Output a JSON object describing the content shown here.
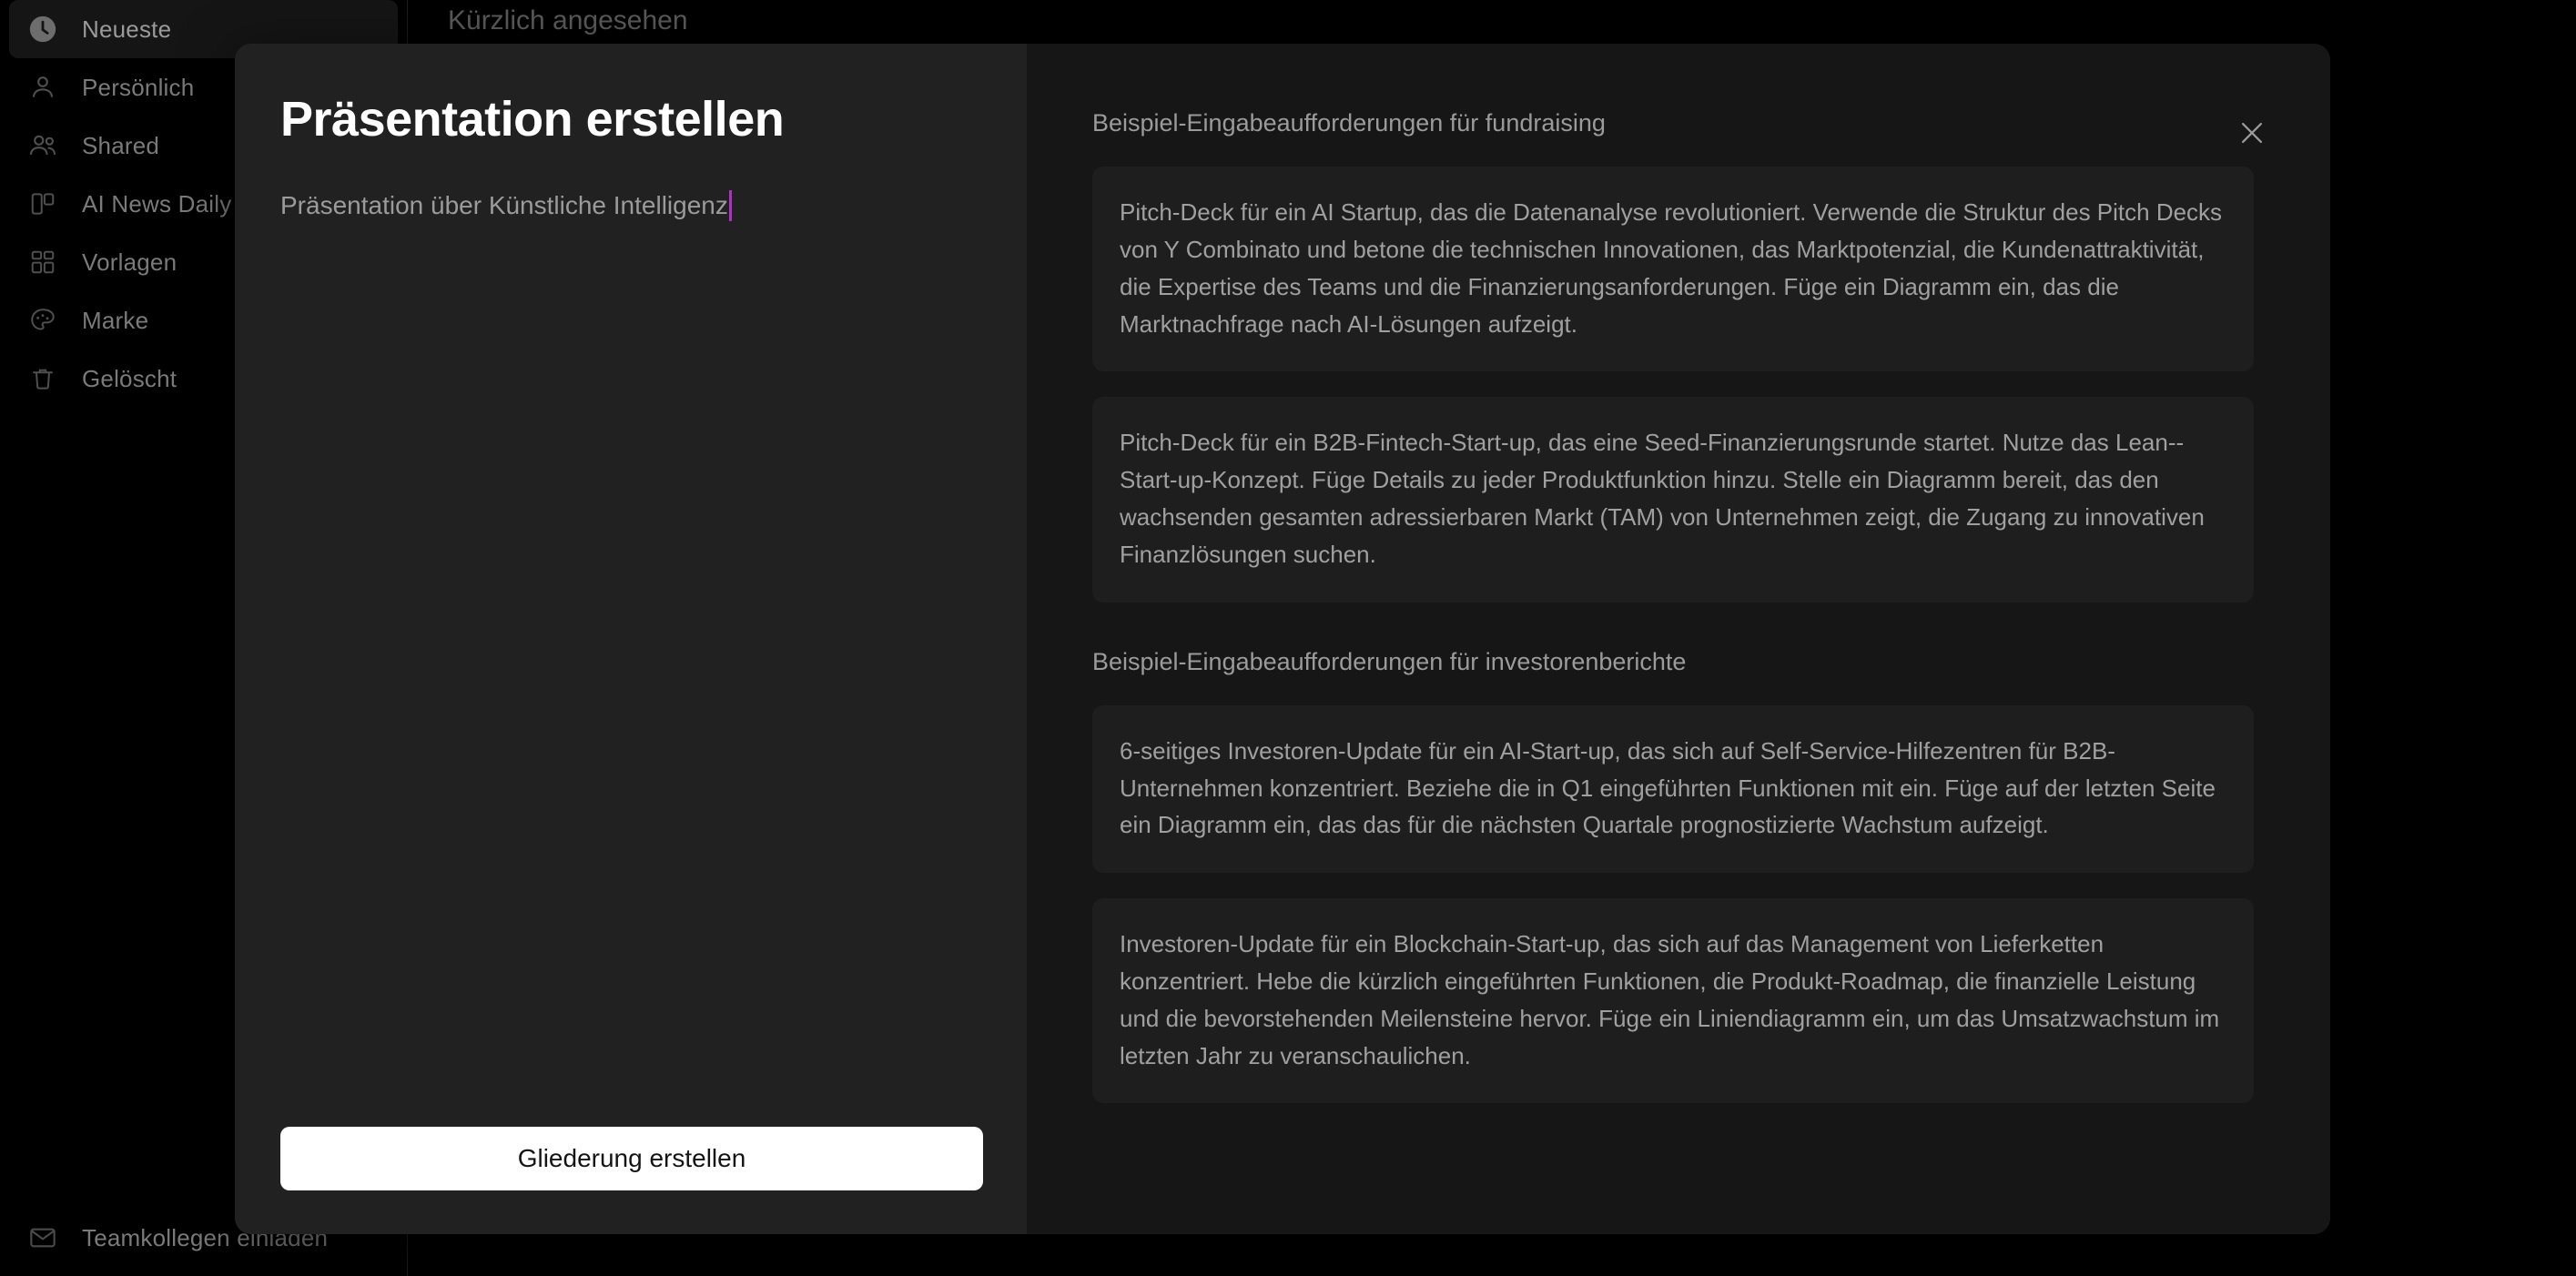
{
  "colors": {
    "page_bg": "#000000",
    "modal_left_bg": "#212121",
    "modal_right_bg": "#161616",
    "card_bg": "#1e1e1e",
    "caret": "#b02fc4",
    "cta_bg": "#ffffff",
    "cta_text": "#141414",
    "muted_text": "#9b9b9b"
  },
  "sidebar": {
    "items": [
      {
        "label": "Neueste",
        "icon": "clock-icon",
        "active": true
      },
      {
        "label": "Persönlich",
        "icon": "person-icon",
        "active": false
      },
      {
        "label": "Shared",
        "icon": "people-icon",
        "active": false
      },
      {
        "label": "AI News Daily",
        "icon": "layout-icon",
        "active": false
      },
      {
        "label": "Vorlagen",
        "icon": "grid-icon",
        "active": false
      },
      {
        "label": "Marke",
        "icon": "palette-icon",
        "active": false
      },
      {
        "label": "Gelöscht",
        "icon": "trash-icon",
        "active": false
      }
    ],
    "bottom": {
      "label": "Teamkollegen einladen",
      "icon": "mail-icon"
    }
  },
  "background": {
    "content_title": "Kürzlich angesehen"
  },
  "modal": {
    "title": "Präsentation erstellen",
    "input": {
      "value": "Präsentation über Künstliche Intelligenz",
      "placeholder": "Präsentation über Künstliche Intelligenz"
    },
    "cta_label": "Gliederung erstellen",
    "close_icon": "close-icon",
    "sections": [
      {
        "heading": "Beispiel-Eingabeaufforderungen für fundraising",
        "cards": [
          "Pitch-Deck für ein AI Startup, das die Datenanalyse revolutioniert. Verwende die Struktur des Pitch Decks von Y Combinato und betone die technischen Innovationen, das Marktpotenzial, die Kundenattraktivität, die Expertise des Teams und die Finanzierungsanforderungen. Füge ein Diagramm ein, das die Marktnachfrage nach AI-Lösungen aufzeigt.",
          "Pitch-Deck für ein B2B-Fintech-Start-up, das eine Seed-Finanzierungsrunde startet. Nutze das Lean--Start-up-Konzept. Füge Details zu jeder Produktfunktion hinzu. Stelle ein Diagramm bereit, das den wachsenden gesamten adressierbaren Markt (TAM) von Unternehmen zeigt, die Zugang zu innovativen Finanzlösungen suchen."
        ]
      },
      {
        "heading": "Beispiel-Eingabeaufforderungen für investorenberichte",
        "cards": [
          "6-seitiges Investoren-Update für ein AI-Start-up, das sich auf Self-Service-Hilfezentren für B2B-Unternehmen konzentriert. Beziehe die in Q1 eingeführten Funktionen mit ein. Füge auf der letzten Seite ein Diagramm ein, das das für die nächsten Quartale prognostizierte Wachstum aufzeigt.",
          "Investoren-Update für ein Blockchain-Start-up, das sich auf das Management von Lieferketten konzentriert. Hebe die kürzlich eingeführten Funktionen, die Produkt-Roadmap, die finanzielle Leistung und die bevorstehenden Meilensteine hervor. Füge ein Liniendiagramm ein, um das Umsatzwachstum im letzten Jahr zu veranschaulichen."
        ]
      }
    ]
  }
}
